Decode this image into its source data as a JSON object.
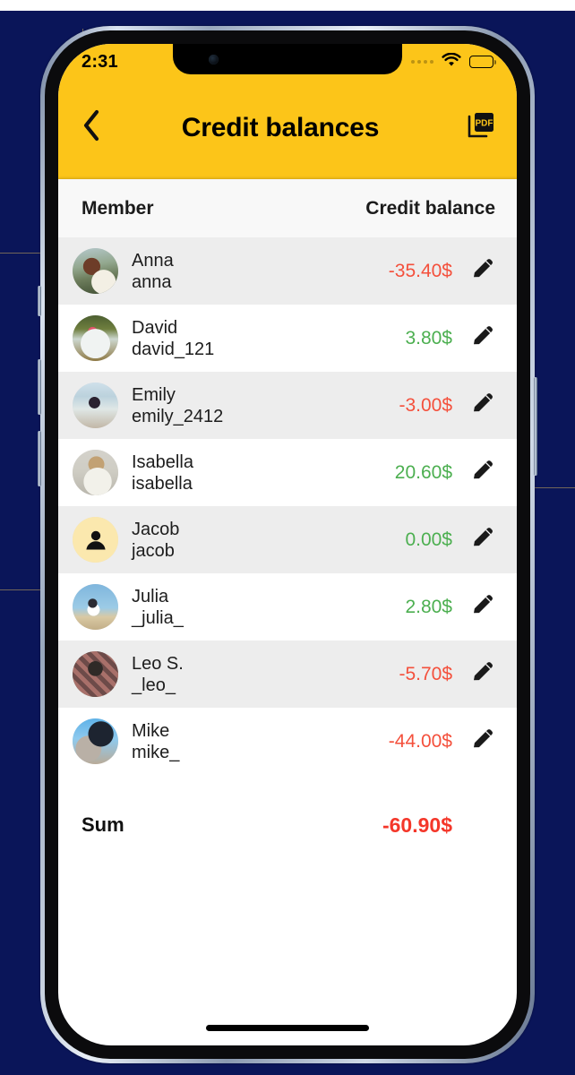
{
  "status_bar": {
    "time": "2:31",
    "signal_icon": "signal-dots-icon",
    "wifi_icon": "wifi-icon",
    "battery_icon": "battery-full-icon"
  },
  "nav": {
    "back_icon": "chevron-left-icon",
    "title": "Credit balances",
    "pdf_label": "PDF",
    "pdf_icon": "pdf-export-icon"
  },
  "columns": {
    "member": "Member",
    "balance": "Credit balance"
  },
  "colors": {
    "header_yellow": "#FCC519",
    "negative_red": "#F4503C",
    "positive_green": "#4CAF50",
    "sum_red": "#F4372A",
    "row_alt": "#EDEDED",
    "backdrop_navy": "#0a1559"
  },
  "members": [
    {
      "name": "Anna",
      "handle": "anna",
      "balance": "-35.40$",
      "sign": "neg",
      "avatar": "photo",
      "art": "art-anna",
      "edit_icon": "pencil-icon"
    },
    {
      "name": "David",
      "handle": "david_121",
      "balance": "3.80$",
      "sign": "pos",
      "avatar": "photo",
      "art": "art-david",
      "edit_icon": "pencil-icon"
    },
    {
      "name": "Emily",
      "handle": "emily_2412",
      "balance": "-3.00$",
      "sign": "neg",
      "avatar": "photo",
      "art": "art-emily",
      "edit_icon": "pencil-icon"
    },
    {
      "name": "Isabella",
      "handle": "isabella",
      "balance": "20.60$",
      "sign": "pos",
      "avatar": "photo",
      "art": "art-isabella",
      "edit_icon": "pencil-icon"
    },
    {
      "name": "Jacob",
      "handle": "jacob",
      "balance": "0.00$",
      "sign": "pos",
      "avatar": "placeholder",
      "art": "",
      "edit_icon": "pencil-icon"
    },
    {
      "name": "Julia",
      "handle": "_julia_",
      "balance": "2.80$",
      "sign": "pos",
      "avatar": "photo",
      "art": "art-julia",
      "edit_icon": "pencil-icon"
    },
    {
      "name": "Leo S.",
      "handle": "_leo_",
      "balance": "-5.70$",
      "sign": "neg",
      "avatar": "photo",
      "art": "art-leo",
      "edit_icon": "pencil-icon"
    },
    {
      "name": "Mike",
      "handle": "mike_",
      "balance": "-44.00$",
      "sign": "neg",
      "avatar": "photo",
      "art": "art-mike",
      "edit_icon": "pencil-icon"
    }
  ],
  "summary": {
    "label": "Sum",
    "value": "-60.90$",
    "sign": "neg"
  }
}
